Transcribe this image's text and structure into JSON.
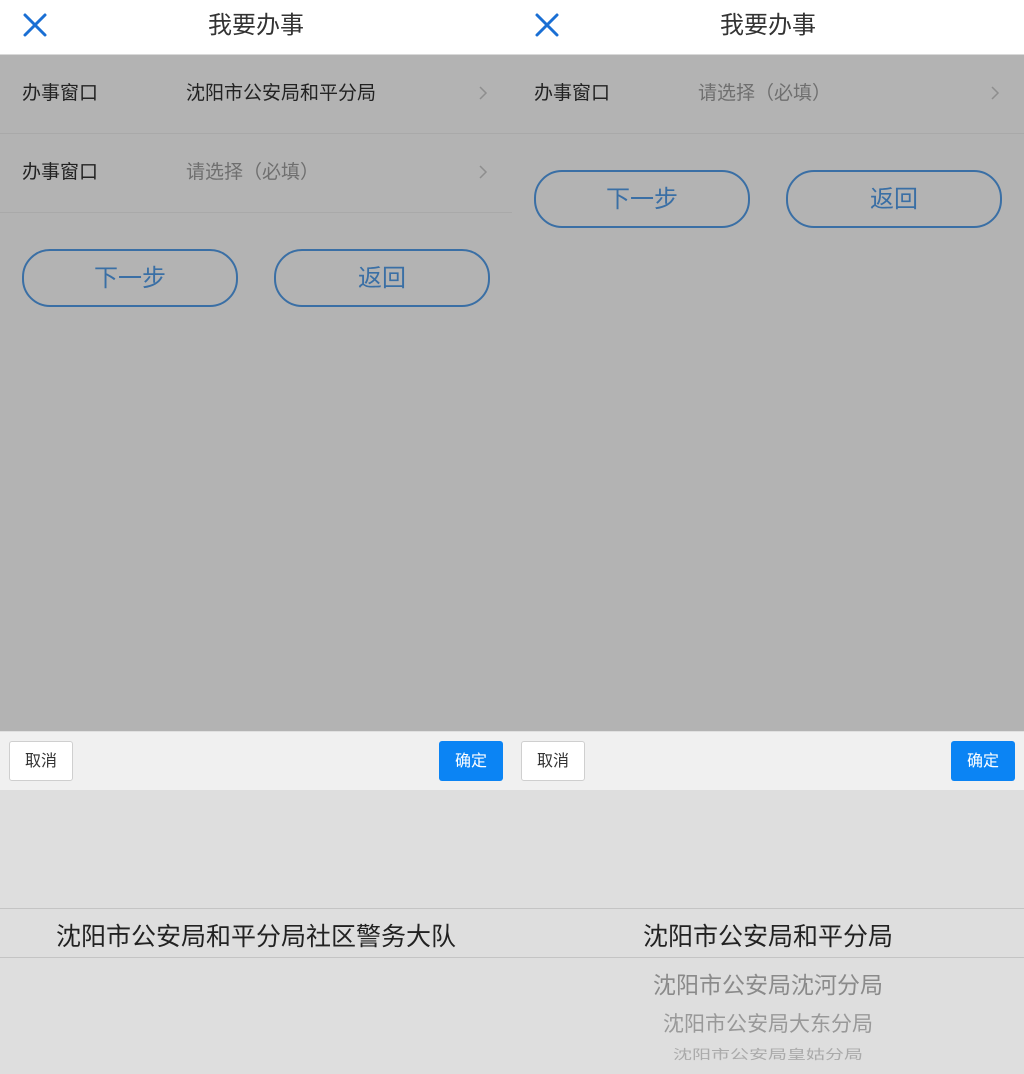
{
  "left": {
    "header": {
      "title": "我要办事",
      "close_icon": "close-icon"
    },
    "rows": [
      {
        "label": "办事窗口",
        "value": "沈阳市公安局和平分局",
        "placeholder": false
      },
      {
        "label": "办事窗口",
        "value": "请选择（必填）",
        "placeholder": true
      }
    ],
    "buttons": {
      "next": "下一步",
      "back": "返回"
    },
    "toolbar": {
      "cancel": "取消",
      "confirm": "确定"
    },
    "picker": {
      "items": [
        "沈阳市公安局和平分局社区警务大队"
      ],
      "selected_index": 0
    }
  },
  "right": {
    "header": {
      "title": "我要办事",
      "close_icon": "close-icon"
    },
    "rows": [
      {
        "label": "办事窗口",
        "value": "请选择（必填）",
        "placeholder": true
      }
    ],
    "buttons": {
      "next": "下一步",
      "back": "返回"
    },
    "toolbar": {
      "cancel": "取消",
      "confirm": "确定"
    },
    "picker": {
      "items": [
        "沈阳市公安局和平分局",
        "沈阳市公安局沈河分局",
        "沈阳市公安局大东分局",
        "沈阳市公安局皇姑分局"
      ],
      "selected_index": 0
    }
  },
  "colors": {
    "accent": "#3a6fa5",
    "close_icon": "#1a6fd4",
    "confirm_button": "#0b84f4",
    "overlay": "#b3b3b3",
    "picker_bg": "#dedede"
  }
}
